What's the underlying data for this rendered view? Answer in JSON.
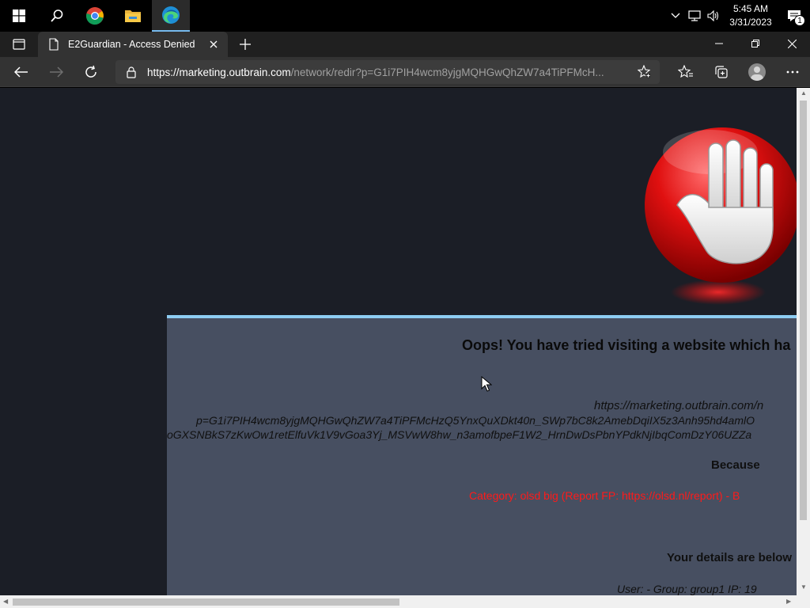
{
  "taskbar": {
    "clock_time": "5:45 AM",
    "clock_date": "3/31/2023",
    "notification_count": "1"
  },
  "browser": {
    "tab_title": "E2Guardian - Access Denied",
    "url_host": "https://marketing.outbrain.com",
    "url_path": "/network/redir?p=G1i7PIH4wcm8yjgMQHGwQhZW7a4TiPFMcH..."
  },
  "page": {
    "title": "Oops! You have tried visiting a website which ha",
    "url_line1": "https://marketing.outbrain.com/n",
    "url_line2": "p=G1i7PIH4wcm8yjgMQHGwQhZW7a4TiPFMcHzQ5YnxQuXDkt40n_SWp7bC8k2AmebDqiIX5z3Anh95hd4amlO",
    "url_line3": "oGXSNBkS7zKwOw1retElfuVk1V9vGoa3Yj_MSVwW8hw_n3amofbpeF1W2_HrnDwDsPbnYPdkNjIbqComDzY06UZZa",
    "because": "Because",
    "category": "Category: olsd big (Report FP: https://olsd.nl/report) - B",
    "details_heading": "Your details are below",
    "user_line": "User: -    Group: group1    IP: 19"
  },
  "colors": {
    "panel_bg": "#474f61",
    "panel_border": "#8ecdf2",
    "page_bg": "#1b1e26",
    "category_red": "#ff1a1a"
  }
}
